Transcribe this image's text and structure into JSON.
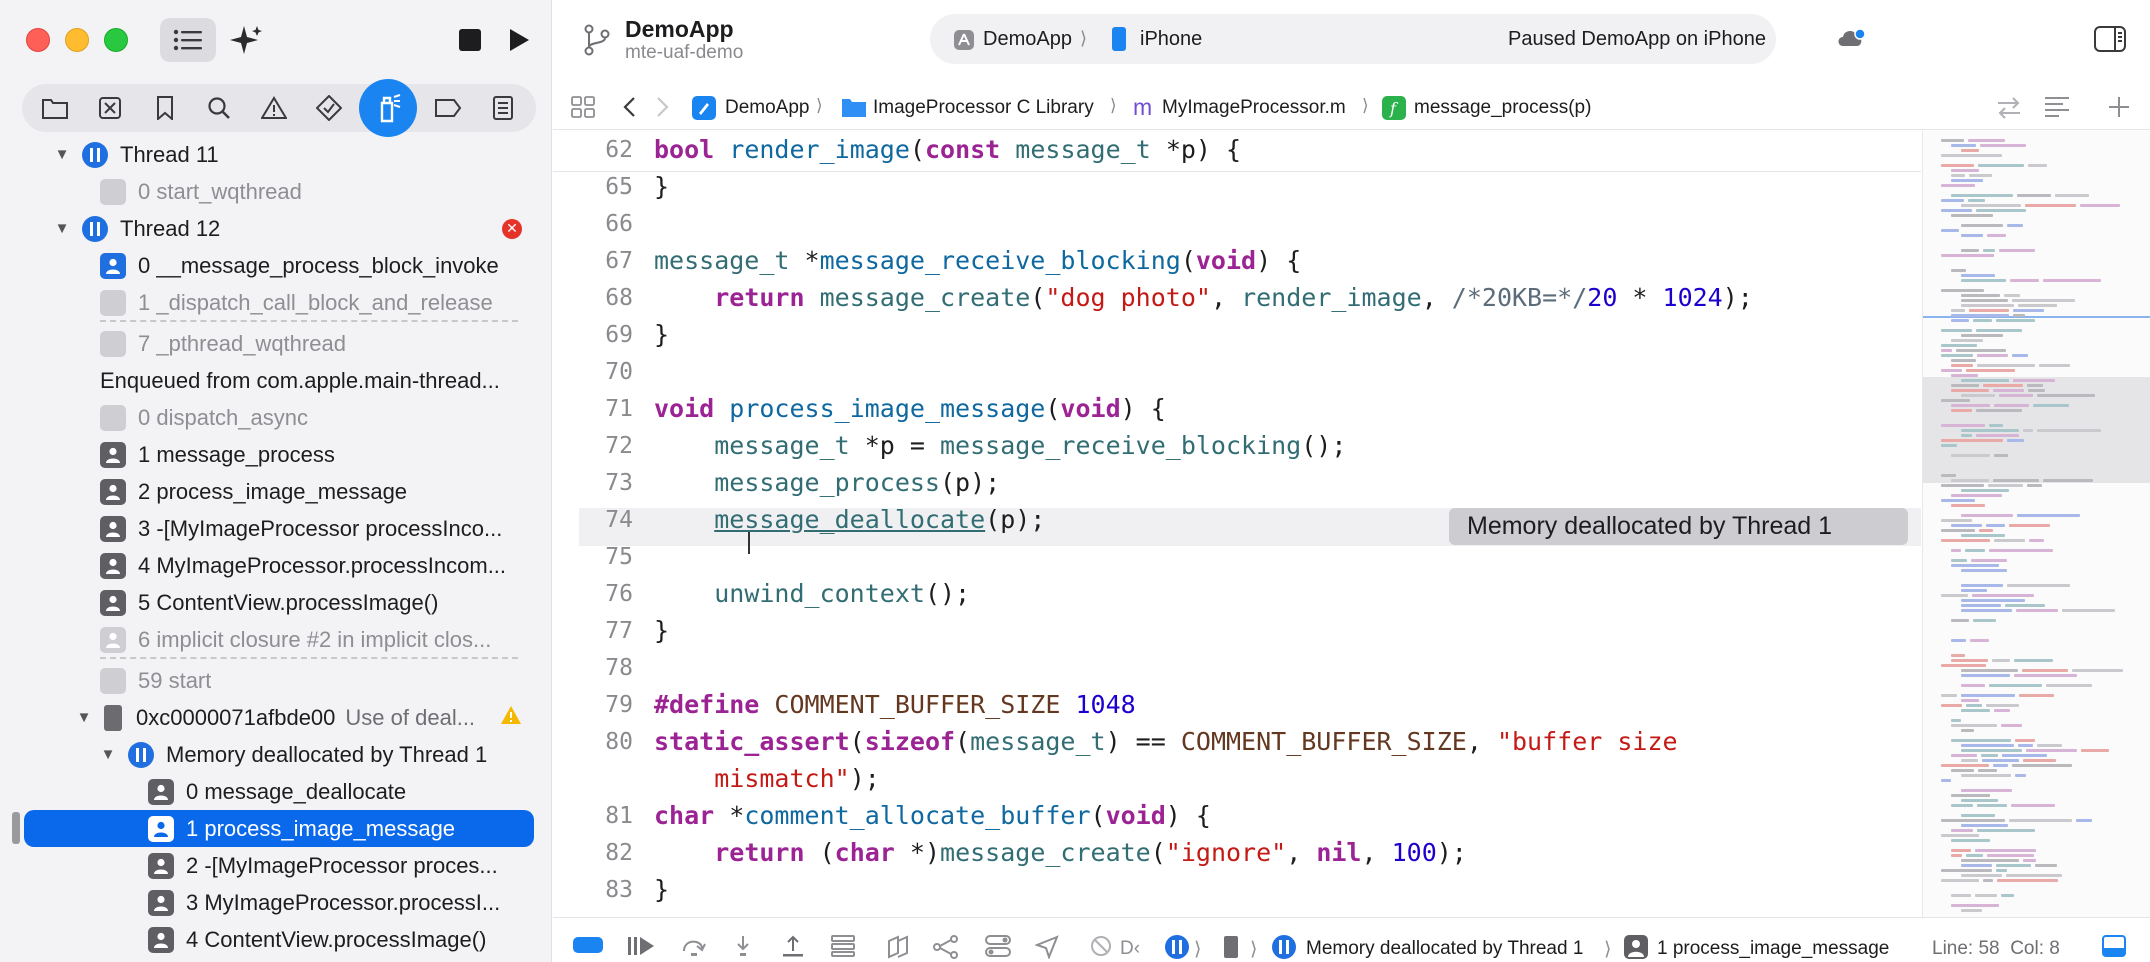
{
  "toolbar": {
    "project_name": "DemoApp",
    "branch": "mte-uaf-demo",
    "scheme_app": "DemoApp",
    "scheme_device": "iPhone",
    "run_status": "Paused DemoApp on iPhone"
  },
  "jumpbar": {
    "items": [
      "DemoApp",
      "ImageProcessor C Library",
      "MyImageProcessor.m",
      "message_process(p)"
    ]
  },
  "debug_navigator": {
    "rows": [
      {
        "label": "Thread 11"
      },
      {
        "label": "0 start_wqthread"
      },
      {
        "label": "Thread 12",
        "badge": "error"
      },
      {
        "label": "0 __message_process_block_invoke"
      },
      {
        "label": "1 _dispatch_call_block_and_release"
      },
      {
        "label": "7 _pthread_wqthread"
      },
      {
        "label": "Enqueued from com.apple.main-thread..."
      },
      {
        "label": "0 dispatch_async"
      },
      {
        "label": "1 message_process"
      },
      {
        "label": "2 process_image_message"
      },
      {
        "label": "3 -[MyImageProcessor processInco..."
      },
      {
        "label": "4 MyImageProcessor.processIncom..."
      },
      {
        "label": "5 ContentView.processImage()"
      },
      {
        "label": "6 implicit closure #2 in implicit clos..."
      },
      {
        "label": "59 start"
      },
      {
        "label": "0xc0000071afbde00",
        "detail": "Use of deal..."
      },
      {
        "label": "Memory deallocated by Thread 1"
      },
      {
        "label": "0 message_deallocate"
      },
      {
        "label": "1 process_image_message"
      },
      {
        "label": "2 -[MyImageProcessor proces..."
      },
      {
        "label": "3 MyImageProcessor.processI..."
      },
      {
        "label": "4 ContentView.processImage()"
      }
    ]
  },
  "editor": {
    "line_numbers": [
      "62",
      "65",
      "66",
      "67",
      "68",
      "69",
      "70",
      "71",
      "72",
      "73",
      "74",
      "75",
      "76",
      "77",
      "78",
      "79",
      "80",
      "81",
      "82",
      "83"
    ],
    "annotation": "Memory deallocated by Thread 1"
  },
  "debug_bar": {
    "breadcrumb_short": "D‹",
    "thread_label": "Memory deallocated by Thread 1",
    "frame_label": "1 process_image_message",
    "line": "Line: 58",
    "col": "Col: 8"
  },
  "colors": {
    "accent": "#0a68ea",
    "thread_icon": "#1f6fe0",
    "error": "#e5332a",
    "warning": "#f5b800",
    "annotation_bg": "#cdcdd1"
  }
}
